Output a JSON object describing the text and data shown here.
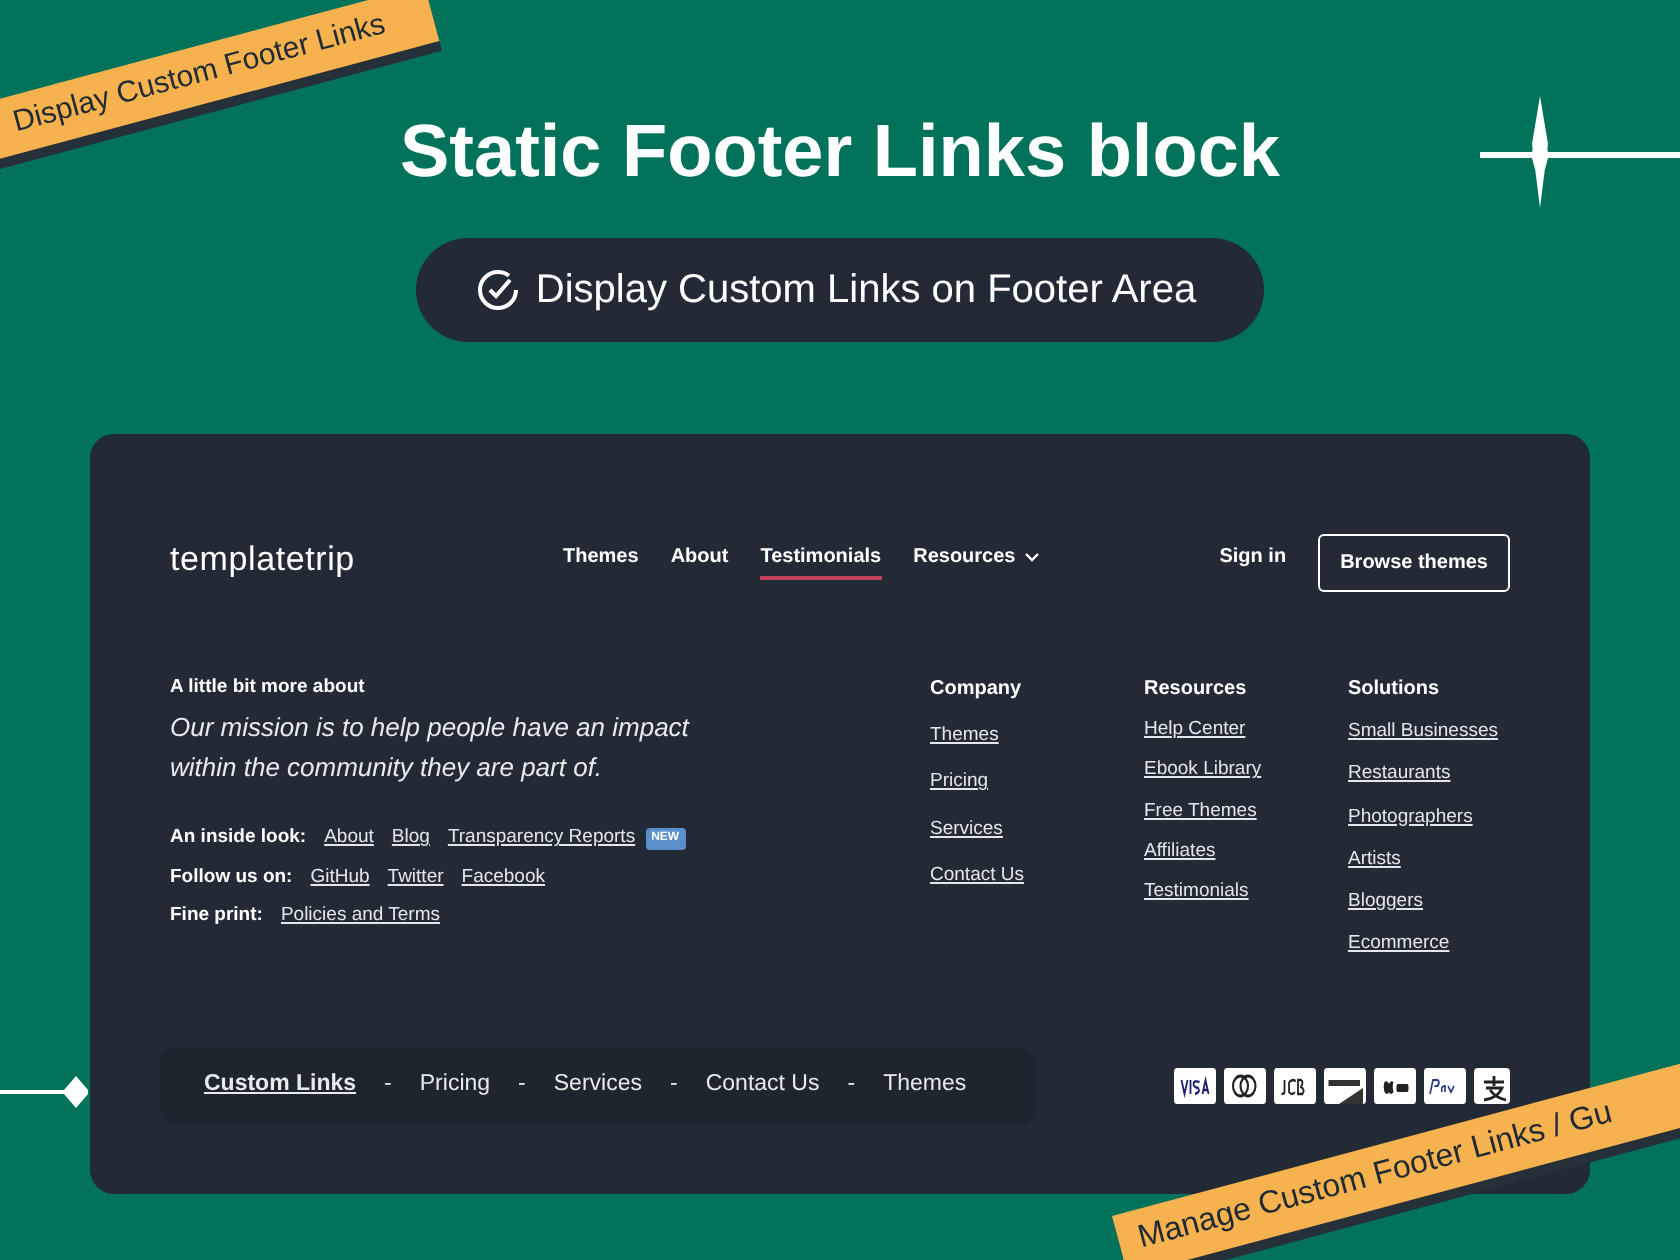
{
  "ribbons": [
    {
      "kind": "top",
      "text": "Display Custom Footer Links"
    },
    {
      "kind": "bottom",
      "text": "Manage Custom Footer Links / Gu"
    }
  ],
  "title": "Static Footer Links block",
  "feature_pill": {
    "text": "Display Custom Links on Footer Area"
  },
  "site": {
    "logo": "templatetrip",
    "nav": [
      {
        "label": "Themes",
        "selected": false,
        "dropdown": false
      },
      {
        "label": "About",
        "selected": false,
        "dropdown": false
      },
      {
        "label": "Testimonials",
        "selected": true,
        "dropdown": false
      },
      {
        "label": "Resources",
        "selected": false,
        "dropdown": true
      }
    ],
    "sign_in": "Sign in",
    "browse_button": "Browse themes",
    "about": {
      "heading": "A little bit more about",
      "mission": "Our mission is to help people have an impact within the community they are part of.",
      "rows": [
        {
          "label": "An inside look:",
          "links": [
            {
              "text": "About"
            },
            {
              "text": "Blog"
            },
            {
              "text": "Transparency Reports",
              "badge": "NEW"
            }
          ]
        },
        {
          "label": "Follow us on:",
          "links": [
            {
              "text": "GitHub"
            },
            {
              "text": "Twitter"
            },
            {
              "text": "Facebook"
            }
          ]
        },
        {
          "label": "Fine print:",
          "links": [
            {
              "text": "Policies and Terms"
            }
          ]
        }
      ]
    },
    "columns": [
      {
        "heading": "Company",
        "links": [
          "Themes",
          "Pricing",
          "Services",
          "Contact Us"
        ]
      },
      {
        "heading": "Resources",
        "links": [
          "Help Center",
          "Ebook Library",
          "Free Themes",
          "Affiliates",
          "Testimonials"
        ]
      },
      {
        "heading": "Solutions",
        "links": [
          "Small Businesses",
          "Restaurants",
          "Photographers",
          "Artists",
          "Bloggers",
          "Ecommerce"
        ]
      }
    ],
    "bottom_links": [
      {
        "text": "Custom Links",
        "selected": true
      },
      {
        "text": "Pricing",
        "selected": false
      },
      {
        "text": "Services",
        "selected": false
      },
      {
        "text": "Contact Us",
        "selected": false
      },
      {
        "text": "Themes",
        "selected": false
      }
    ],
    "separator": "-",
    "payment_methods": [
      {
        "kind": "visa"
      },
      {
        "kind": "mastercard"
      },
      {
        "kind": "jcb"
      },
      {
        "kind": "discover"
      },
      {
        "kind": "applepay"
      },
      {
        "kind": "paypal"
      },
      {
        "kind": "alipay"
      }
    ]
  }
}
